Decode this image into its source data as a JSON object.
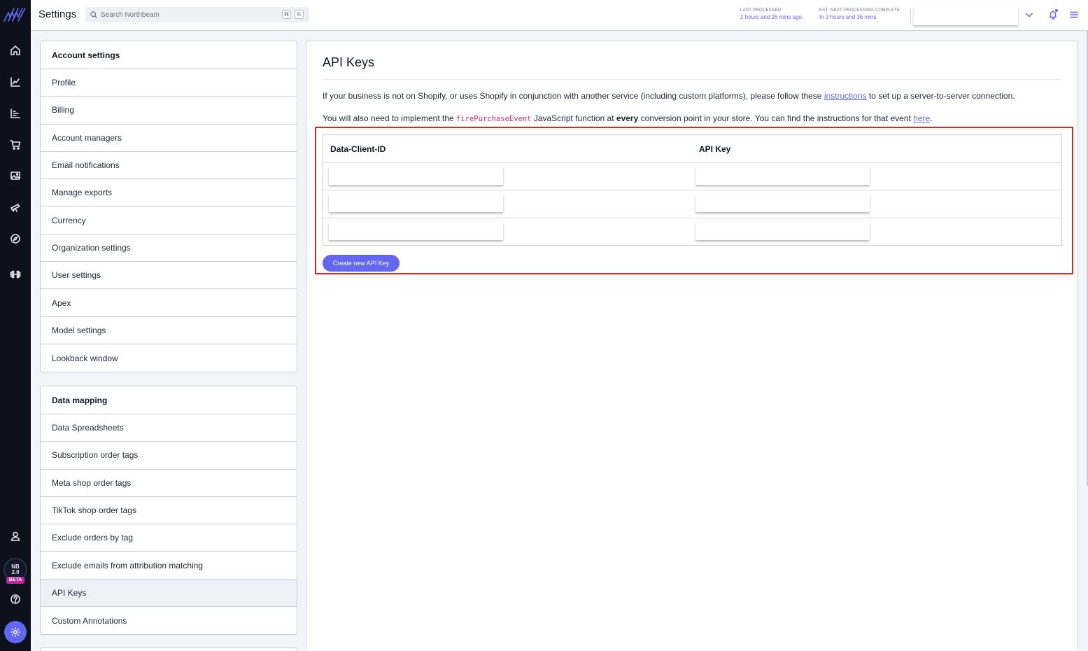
{
  "header": {
    "title": "Settings",
    "search_placeholder": "Search Northbeam",
    "search_kbd_1": "⌘",
    "search_kbd_2": "K",
    "last_processed_label": "LAST PROCESSED",
    "last_processed_value": "2 hours and 26 mins ago",
    "next_processing_label": "EST. NEXT PROCESSING COMPLETE",
    "next_processing_value": "In 3 hours and 36 mins"
  },
  "rail": {
    "icons": [
      "home-icon",
      "line-chart-icon",
      "bar-chart-icon",
      "cart-icon",
      "image-icon",
      "telescope-icon",
      "compass-icon",
      "dumbbell-icon"
    ],
    "badge_line1": "NB",
    "badge_line2": "2.0",
    "badge_beta": "BETA"
  },
  "account_settings": {
    "heading": "Account settings",
    "items": [
      "Profile",
      "Billing",
      "Account managers",
      "Email notifications",
      "Manage exports",
      "Currency",
      "Organization settings",
      "User settings",
      "Apex",
      "Model settings",
      "Lookback window"
    ]
  },
  "data_mapping": {
    "heading": "Data mapping",
    "items": [
      "Data Spreadsheets",
      "Subscription order tags",
      "Meta shop order tags",
      "TikTok shop order tags",
      "Exclude orders by tag",
      "Exclude emails from attribution matching",
      "API Keys",
      "Custom Annotations"
    ],
    "active_item": "API Keys"
  },
  "main": {
    "title": "API Keys",
    "para1_before": "If your business is not on Shopify, or uses Shopify in conjunction with another service (including custom platforms), please follow these ",
    "para1_link": "instructions",
    "para1_after": " to set up a server-to-server connection.",
    "para2_before": "You will also need to implement the ",
    "para2_code": "firePurchaseEvent",
    "para2_mid": " JavaScript function at ",
    "para2_bold": "every",
    "para2_after": " conversion point in your store. You can find the instructions for that event ",
    "para2_link": "here",
    "para2_end": ".",
    "table": {
      "col1": "Data-Client-ID",
      "col2": "API Key"
    },
    "create_button": "Create new API Key"
  },
  "colors": {
    "accent": "#6366f1",
    "highlight_border": "#e02424",
    "code": "#db2777",
    "rail_bg": "#0d111c"
  }
}
